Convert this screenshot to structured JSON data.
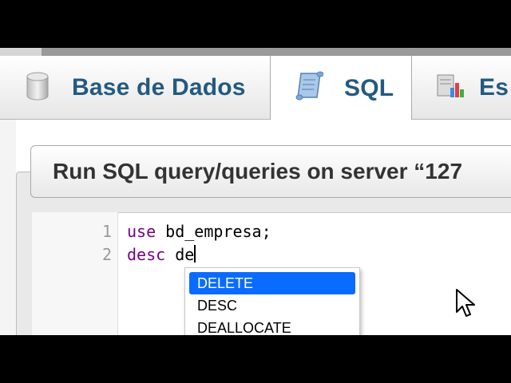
{
  "tabs": [
    {
      "label": "Base de Dados",
      "icon": "database-icon",
      "active": false
    },
    {
      "label": "SQL",
      "icon": "sql-scroll-icon",
      "active": true
    },
    {
      "label": "Es",
      "icon": "statistics-chart-icon",
      "active": false
    }
  ],
  "panel": {
    "title": "Run SQL query/queries on server “127"
  },
  "editor": {
    "line_numbers": [
      "1",
      "2"
    ],
    "lines": [
      {
        "keyword": "use",
        "rest": " bd_empresa;"
      },
      {
        "keyword": "desc",
        "rest": " de"
      }
    ]
  },
  "autocomplete": {
    "items": [
      "DELETE",
      "DESC",
      "DEALLOCATE"
    ],
    "selected_index": 0
  },
  "colors": {
    "tab_text": "#235a81",
    "keyword": "#770088",
    "selection": "#0a6bff"
  }
}
